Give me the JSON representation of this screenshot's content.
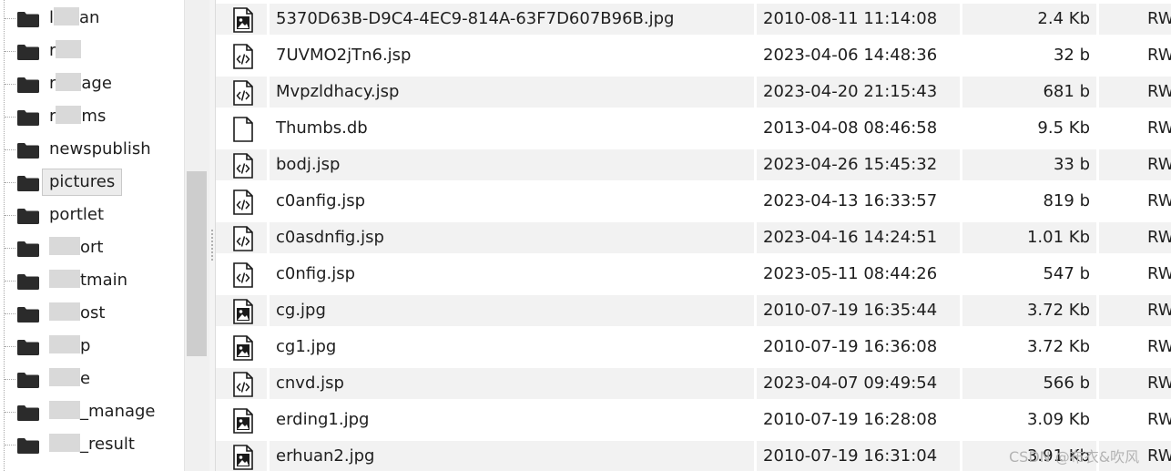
{
  "tree": {
    "items": [
      {
        "label": "",
        "prefix": "l",
        "suffix": "an",
        "selected": false
      },
      {
        "label": "",
        "prefix": "r",
        "suffix": "",
        "selected": false
      },
      {
        "label": "",
        "prefix": "r",
        "suffix": "age",
        "selected": false
      },
      {
        "label": "",
        "prefix": "r",
        "suffix": "ms",
        "selected": false
      },
      {
        "label": "newspublish",
        "prefix": "",
        "suffix": "",
        "selected": false
      },
      {
        "label": "pictures",
        "prefix": "",
        "suffix": "",
        "selected": true
      },
      {
        "label": "portlet",
        "prefix": "",
        "suffix": "",
        "selected": false
      },
      {
        "label": "",
        "prefix": "",
        "suffix": "ort",
        "selected": false
      },
      {
        "label": "",
        "prefix": "",
        "suffix": "tmain",
        "selected": false
      },
      {
        "label": "",
        "prefix": "",
        "suffix": "ost",
        "selected": false
      },
      {
        "label": "",
        "prefix": "",
        "suffix": "p",
        "selected": false
      },
      {
        "label": "",
        "prefix": "",
        "suffix": "e",
        "selected": false
      },
      {
        "label": "",
        "prefix": "",
        "suffix": "_manage",
        "selected": false
      },
      {
        "label": "",
        "prefix": "",
        "suffix": "_result",
        "selected": false
      }
    ]
  },
  "files": {
    "rows": [
      {
        "name": "5370D63B-D9C4-4EC9-814A-63F7D607B96B.jpg",
        "date": "2010-08-11 11:14:08",
        "size": "2.4 Kb",
        "perm": "RW",
        "icon": "image-file-icon"
      },
      {
        "name": "7UVMO2jTn6.jsp",
        "date": "2023-04-06 14:48:36",
        "size": "32 b",
        "perm": "RW",
        "icon": "code-file-icon"
      },
      {
        "name": "Mvpzldhacy.jsp",
        "date": "2023-04-20 21:15:43",
        "size": "681 b",
        "perm": "RW",
        "icon": "code-file-icon"
      },
      {
        "name": "Thumbs.db",
        "date": "2013-04-08 08:46:58",
        "size": "9.5 Kb",
        "perm": "RW",
        "icon": "blank-file-icon"
      },
      {
        "name": "bodj.jsp",
        "date": "2023-04-26 15:45:32",
        "size": "33 b",
        "perm": "RW",
        "icon": "code-file-icon"
      },
      {
        "name": "c0anfig.jsp",
        "date": "2023-04-13 16:33:57",
        "size": "819 b",
        "perm": "RW",
        "icon": "code-file-icon"
      },
      {
        "name": "c0asdnfig.jsp",
        "date": "2023-04-16 14:24:51",
        "size": "1.01 Kb",
        "perm": "RW",
        "icon": "code-file-icon"
      },
      {
        "name": "c0nfig.jsp",
        "date": "2023-05-11 08:44:26",
        "size": "547 b",
        "perm": "RW",
        "icon": "code-file-icon"
      },
      {
        "name": "cg.jpg",
        "date": "2010-07-19 16:35:44",
        "size": "3.72 Kb",
        "perm": "RW",
        "icon": "image-file-icon"
      },
      {
        "name": "cg1.jpg",
        "date": "2010-07-19 16:36:08",
        "size": "3.72 Kb",
        "perm": "RW",
        "icon": "image-file-icon"
      },
      {
        "name": "cnvd.jsp",
        "date": "2023-04-07 09:49:54",
        "size": "566 b",
        "perm": "RW",
        "icon": "code-file-icon"
      },
      {
        "name": "erding1.jpg",
        "date": "2010-07-19 16:28:08",
        "size": "3.09 Kb",
        "perm": "RW",
        "icon": "image-file-icon"
      },
      {
        "name": "erhuan2.jpg",
        "date": "2010-07-19 16:31:04",
        "size": "3.91 Kb",
        "perm": "RW",
        "icon": "image-file-icon"
      }
    ]
  },
  "watermark": "CSDN @布衣&吹风",
  "colors": {
    "row_alt": "#f2f2f2",
    "selected_bg": "#ececec",
    "icon": "#1a1a1a"
  }
}
